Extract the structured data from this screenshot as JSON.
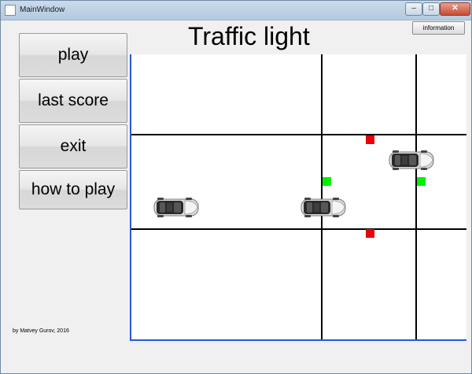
{
  "window": {
    "title": "MainWindow",
    "controls": {
      "minimize": "–",
      "maximize": "□",
      "close": "✕"
    }
  },
  "app": {
    "title": "Traffic light",
    "info_button": "information",
    "menu": [
      "play",
      "last score",
      "exit",
      "how to play"
    ],
    "credit": "by Matvey Gurov, 2016"
  },
  "scene": {
    "light_colors": {
      "red": "#e8000b",
      "green": "#00f000"
    },
    "car_icon": "car-topdown-icon"
  }
}
